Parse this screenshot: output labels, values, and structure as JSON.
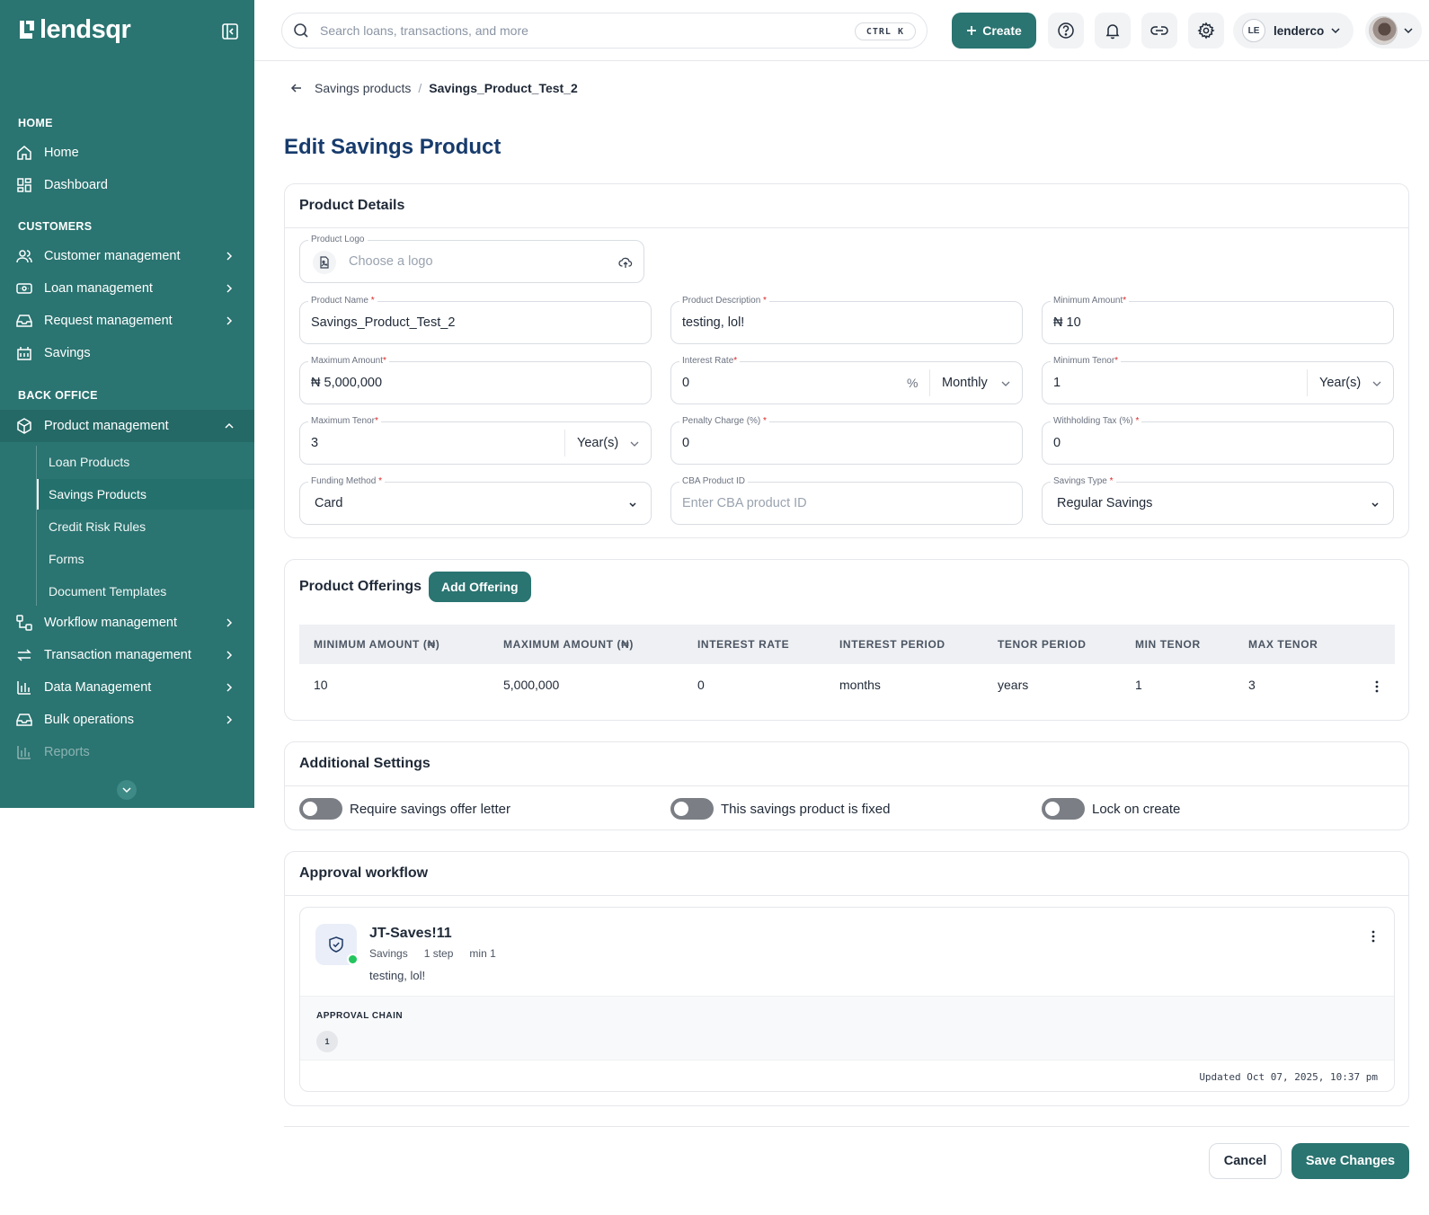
{
  "brand": {
    "name": "lendsqr"
  },
  "sidebar": {
    "sections": {
      "home": "HOME",
      "customers": "CUSTOMERS",
      "back_office": "BACK OFFICE"
    },
    "home_items": [
      "Home",
      "Dashboard"
    ],
    "customer_items": [
      "Customer management",
      "Loan management",
      "Request management",
      "Savings"
    ],
    "product_management": "Product management",
    "product_sub_items": [
      "Loan Products",
      "Savings Products",
      "Credit Risk Rules",
      "Forms",
      "Document Templates"
    ],
    "back_office_items": [
      "Workflow management",
      "Transaction management",
      "Data Management",
      "Bulk operations",
      "Reports"
    ]
  },
  "topbar": {
    "search_placeholder": "Search loans, transactions, and more",
    "shortcut": "CTRL K",
    "create_label": "Create",
    "user_initials": "LE",
    "user_name": "lenderco"
  },
  "breadcrumb": {
    "parent": "Savings products",
    "separator": "/",
    "current": "Savings_Product_Test_2"
  },
  "page_title": "Edit Savings Product",
  "product_details": {
    "title": "Product Details",
    "logo": {
      "label": "Product Logo",
      "placeholder": "Choose a logo"
    },
    "product_name": {
      "label": "Product Name",
      "value": "Savings_Product_Test_2"
    },
    "product_description": {
      "label": "Product Description",
      "value": "testing, lol!"
    },
    "minimum_amount": {
      "label": "Minimum Amount",
      "value": "₦ 10"
    },
    "maximum_amount": {
      "label": "Maximum Amount",
      "value": "₦ 5,000,000"
    },
    "interest_rate": {
      "label": "Interest Rate",
      "value": "0",
      "suffix": "%",
      "period": "Monthly"
    },
    "minimum_tenor": {
      "label": "Minimum Tenor",
      "value": "1",
      "unit": "Year(s)"
    },
    "maximum_tenor": {
      "label": "Maximum Tenor",
      "value": "3",
      "unit": "Year(s)"
    },
    "penalty_charge": {
      "label": "Penalty Charge (%)",
      "value": "0"
    },
    "withholding_tax": {
      "label": "Withholding Tax (%)",
      "value": "0"
    },
    "funding_method": {
      "label": "Funding Method",
      "value": "Card"
    },
    "cba_product_id": {
      "label": "CBA Product ID",
      "placeholder": "Enter CBA product ID"
    },
    "savings_type": {
      "label": "Savings Type",
      "value": "Regular Savings"
    },
    "required_mark": "*"
  },
  "offerings": {
    "title": "Product Offerings",
    "add_label": "Add Offering",
    "headers": [
      "MINIMUM AMOUNT (₦)",
      "MAXIMUM AMOUNT (₦)",
      "INTEREST RATE",
      "INTEREST PERIOD",
      "TENOR PERIOD",
      "MIN TENOR",
      "MAX TENOR"
    ],
    "rows": [
      [
        "10",
        "5,000,000",
        "0",
        "months",
        "years",
        "1",
        "3"
      ]
    ]
  },
  "additional_settings": {
    "title": "Additional Settings",
    "toggles": [
      "Require savings offer letter",
      "This savings product is fixed",
      "Lock on create"
    ]
  },
  "approval_workflow": {
    "title": "Approval workflow",
    "name": "JT-Saves!11",
    "type": "Savings",
    "steps": "1 step",
    "min": "min 1",
    "description": "testing, lol!",
    "chain_label": "APPROVAL CHAIN",
    "chain_steps": [
      "1"
    ],
    "updated": "Updated Oct 07, 2025, 10:37 pm"
  },
  "footer": {
    "cancel_label": "Cancel",
    "save_label": "Save Changes"
  },
  "colors": {
    "brand": "#2a7471",
    "title": "#173b6c",
    "success": "#22c55e"
  }
}
